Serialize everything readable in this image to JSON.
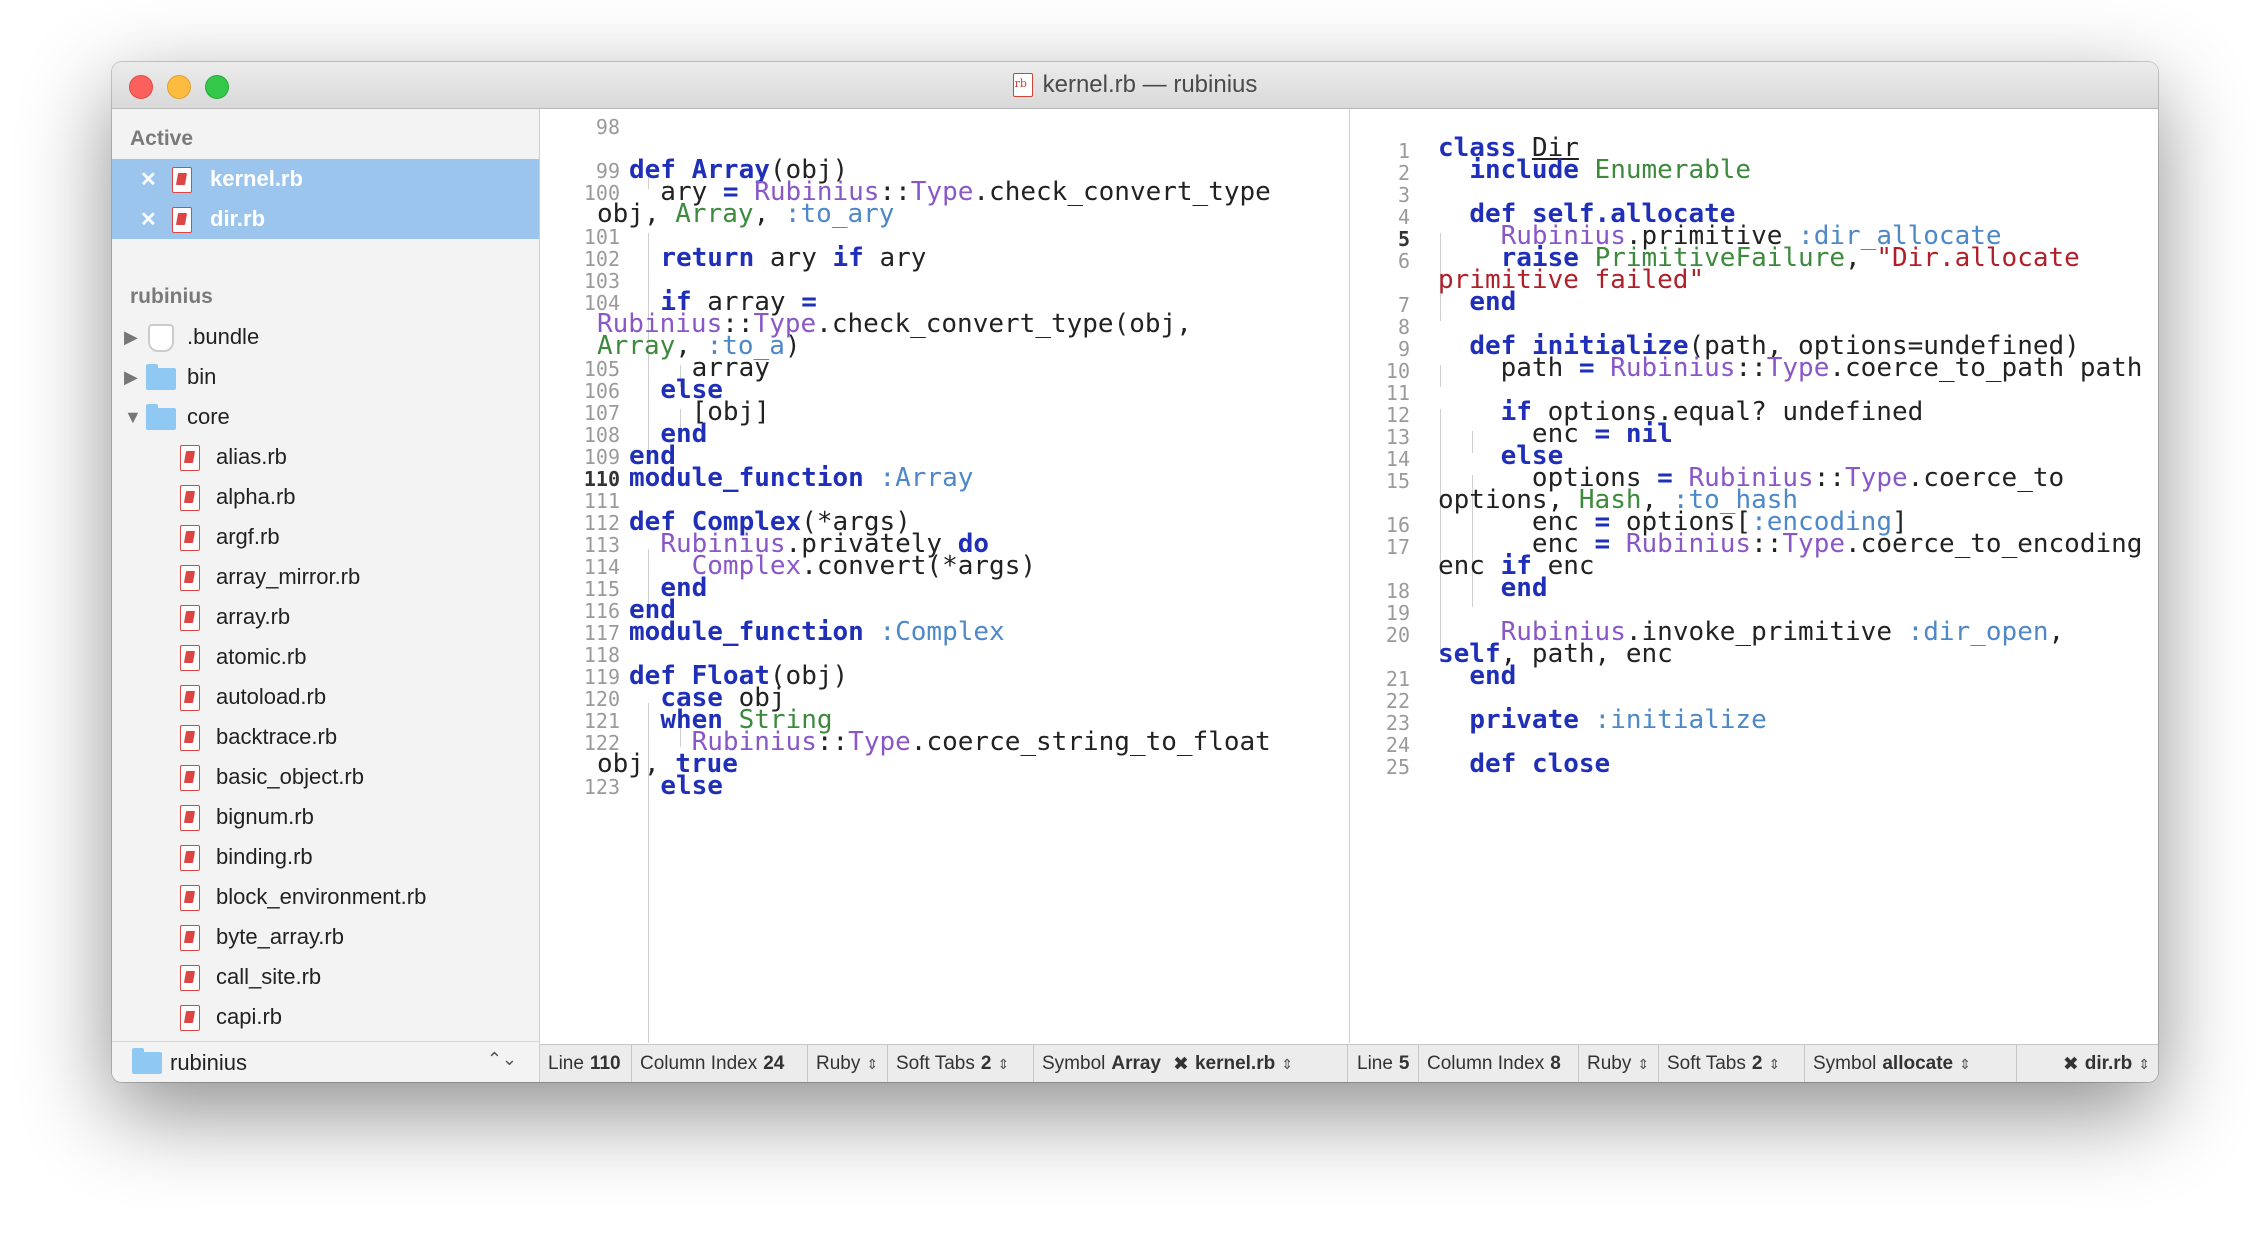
{
  "window": {
    "title": "kernel.rb — rubinius"
  },
  "sidebar": {
    "active_header": "Active",
    "active_items": [
      {
        "label": "kernel.rb"
      },
      {
        "label": "dir.rb"
      }
    ],
    "project_header": "rubinius",
    "tree": [
      {
        "label": ".bundle"
      },
      {
        "label": "bin"
      },
      {
        "label": "core"
      }
    ],
    "files": [
      "alias.rb",
      "alpha.rb",
      "argf.rb",
      "array_mirror.rb",
      "array.rb",
      "atomic.rb",
      "autoload.rb",
      "backtrace.rb",
      "basic_object.rb",
      "bignum.rb",
      "binding.rb",
      "block_environment.rb",
      "byte_array.rb",
      "call_site.rb",
      "capi.rb"
    ],
    "footer_project": "rubinius"
  },
  "left_pane": {
    "line_numbers": [
      "98",
      "99",
      "100",
      "101",
      "102",
      "103",
      "104",
      "105",
      "106",
      "107",
      "108",
      "109",
      "110",
      "111",
      "112",
      "113",
      "114",
      "115",
      "116",
      "117",
      "118",
      "119",
      "120",
      "121",
      "122",
      "123"
    ]
  },
  "right_pane": {
    "line_numbers": [
      "1",
      "2",
      "3",
      "4",
      "5",
      "6",
      "7",
      "8",
      "9",
      "10",
      "11",
      "12",
      "13",
      "14",
      "15",
      "16",
      "17",
      "18",
      "19",
      "20",
      "21",
      "22",
      "23",
      "24",
      "25"
    ]
  },
  "status_left": {
    "line_label": "Line",
    "line": "110",
    "col_label": "Column Index",
    "col": "24",
    "syntax": "Ruby",
    "tabs_label": "Soft Tabs",
    "tabs": "2",
    "symbol_label": "Symbol",
    "symbol": "Array",
    "file": "kernel.rb"
  },
  "status_right": {
    "line_label": "Line",
    "line": "5",
    "col_label": "Column Index",
    "col": "8",
    "syntax": "Ruby",
    "tabs_label": "Soft Tabs",
    "tabs": "2",
    "symbol_label": "Symbol",
    "symbol": "allocate",
    "file": "dir.rb"
  }
}
